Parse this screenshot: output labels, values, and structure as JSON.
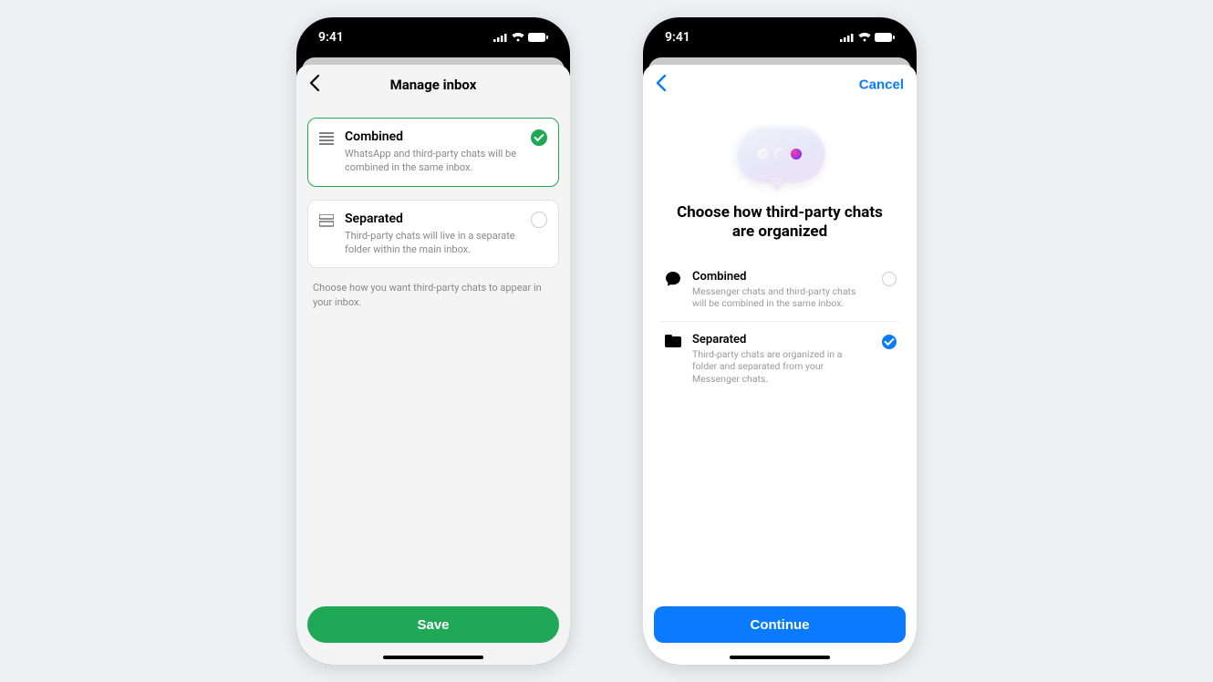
{
  "status": {
    "time": "9:41"
  },
  "phone1": {
    "nav_title": "Manage inbox",
    "options": {
      "combined": {
        "title": "Combined",
        "desc": "WhatsApp and third-party chats will be combined in the same inbox."
      },
      "separated": {
        "title": "Separated",
        "desc": "Third-party chats will live in a separate folder within the main inbox."
      }
    },
    "helper": "Choose how you want third-party chats to appear in your inbox.",
    "save_label": "Save"
  },
  "phone2": {
    "cancel_label": "Cancel",
    "heading": "Choose how third-party chats are organized",
    "options": {
      "combined": {
        "title": "Combined",
        "desc": "Messenger chats and third-party chats will be combined in the same inbox."
      },
      "separated": {
        "title": "Separated",
        "desc": "Third-party chats are organized in a folder and separated from your Messenger chats."
      }
    },
    "continue_label": "Continue"
  }
}
